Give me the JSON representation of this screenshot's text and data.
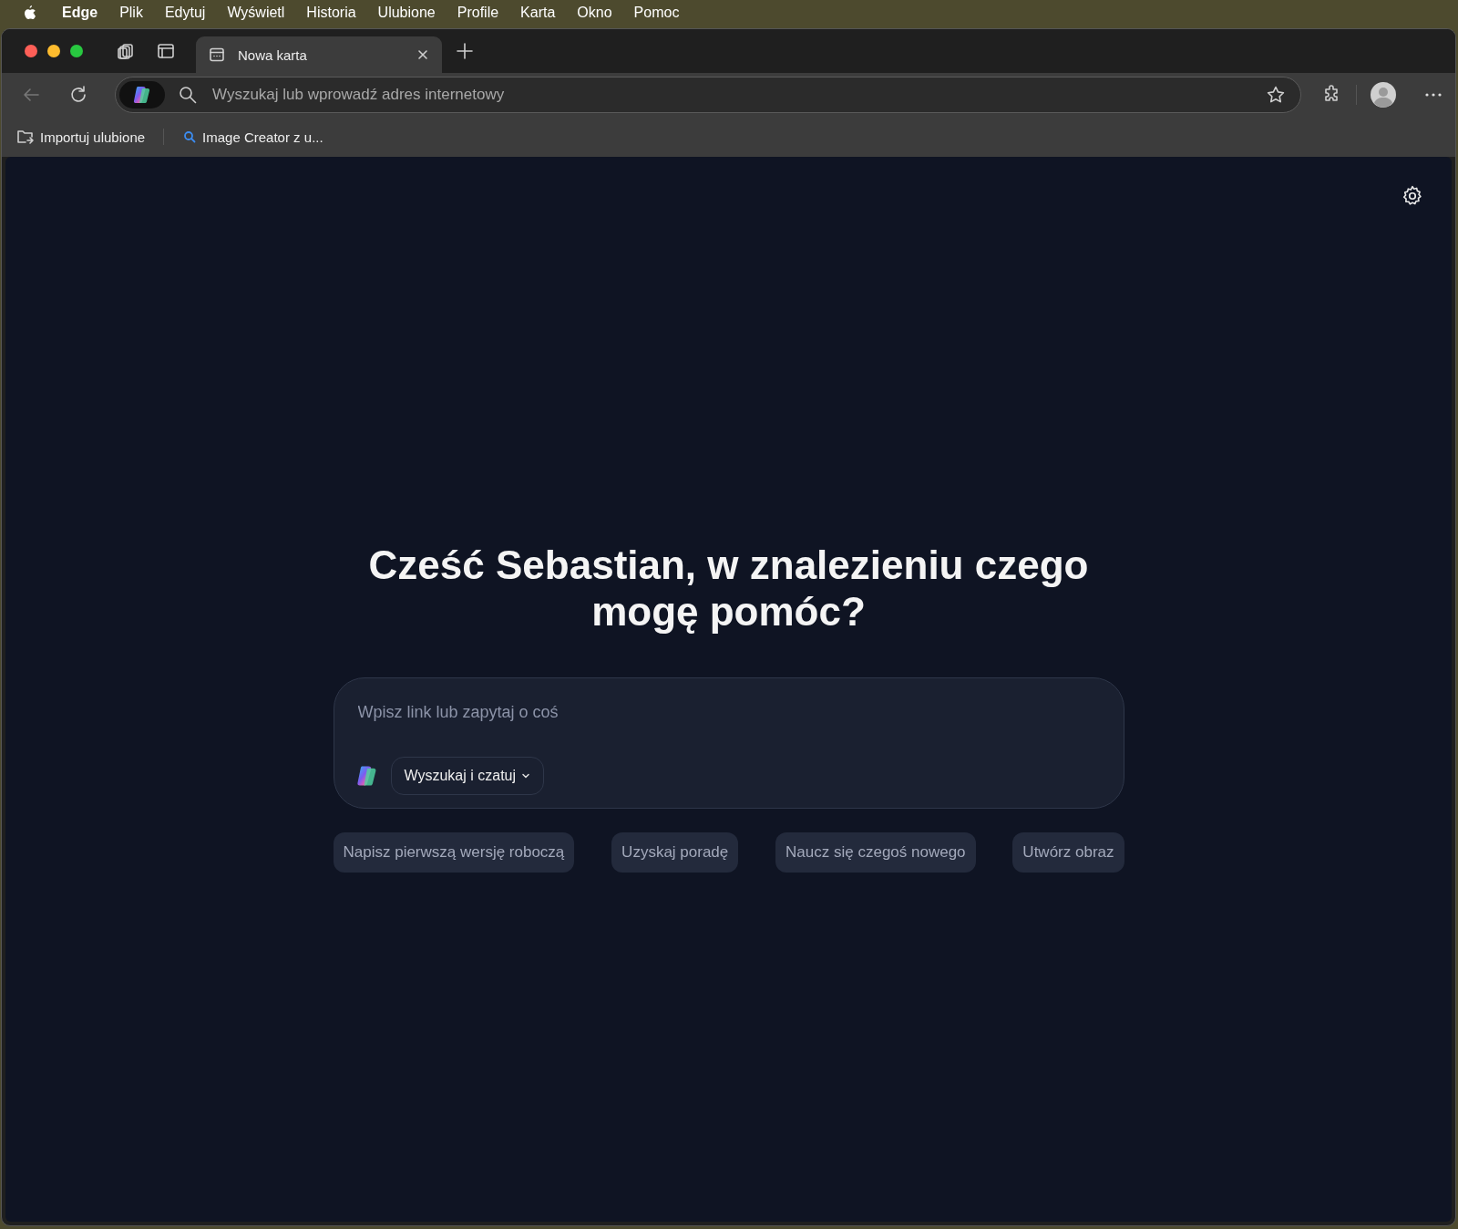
{
  "menu_bar": {
    "items": [
      {
        "label": "Edge",
        "kind": "app"
      },
      {
        "label": "Plik",
        "kind": "menu"
      },
      {
        "label": "Edytuj",
        "kind": "menu"
      },
      {
        "label": "Wyświetl",
        "kind": "menu"
      },
      {
        "label": "Historia",
        "kind": "menu"
      },
      {
        "label": "Ulubione",
        "kind": "menu"
      },
      {
        "label": "Profile",
        "kind": "menu"
      },
      {
        "label": "Karta",
        "kind": "menu"
      },
      {
        "label": "Okno",
        "kind": "menu"
      },
      {
        "label": "Pomoc",
        "kind": "menu"
      }
    ]
  },
  "tabs": [
    {
      "label": "Nowa karta",
      "selected": true
    }
  ],
  "address_bar": {
    "placeholder": "Wyszukaj lub wprowadź adres internetowy"
  },
  "favorites_bar": {
    "items": [
      {
        "label": "Importuj ulubione",
        "kind": "import"
      },
      {
        "label": "Image Creator z u...",
        "kind": "search"
      }
    ]
  },
  "page": {
    "heading": "Cześć Sebastian, w znalezieniu czego mogę pomóc?",
    "prompt": {
      "placeholder": "Wpisz link lub zapytaj o coś",
      "mode": "Wyszukaj i czatuj"
    },
    "suggestions": [
      "Napisz pierwszą wersję roboczą",
      "Uzyskaj poradę",
      "Naucz się czegoś nowego",
      "Utwórz obraz"
    ]
  }
}
